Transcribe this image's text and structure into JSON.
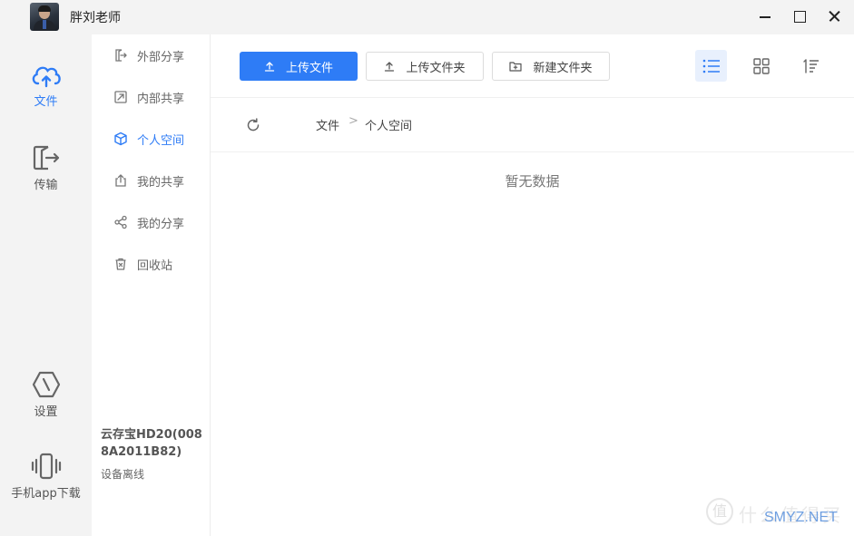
{
  "window": {
    "title": "胖刘老师",
    "controls": {
      "minimize": "minimize-icon",
      "maximize": "maximize-icon",
      "close": "close-icon"
    }
  },
  "rail": {
    "items": [
      {
        "label": "文件",
        "icon": "cloud-icon",
        "active": true
      },
      {
        "label": "传输",
        "icon": "transfer-icon",
        "active": false
      },
      {
        "label": "设置",
        "icon": "settings-icon",
        "active": false
      },
      {
        "label": "手机app下载",
        "icon": "phone-icon",
        "active": false
      }
    ]
  },
  "subnav": {
    "items": [
      {
        "label": "外部分享",
        "icon": "external-share-icon",
        "active": false
      },
      {
        "label": "内部共享",
        "icon": "internal-share-icon",
        "active": false
      },
      {
        "label": "个人空间",
        "icon": "cube-icon",
        "active": true
      },
      {
        "label": "我的共享",
        "icon": "upload-share-icon",
        "active": false
      },
      {
        "label": "我的分享",
        "icon": "share-nodes-icon",
        "active": false
      },
      {
        "label": "回收站",
        "icon": "trash-icon",
        "active": false
      }
    ],
    "device": {
      "name": "云存宝HD20(0088A2011B82)",
      "status": "设备离线"
    }
  },
  "toolbar": {
    "upload_file": "上传文件",
    "upload_folder": "上传文件夹",
    "new_folder": "新建文件夹",
    "view_list_icon": "list-view-icon",
    "view_grid_icon": "grid-view-icon",
    "sort_icon": "sort-icon"
  },
  "breadcrumb": {
    "items": [
      "文件",
      "个人空间"
    ],
    "separator": ">"
  },
  "content": {
    "empty_text": "暂无数据"
  },
  "watermark": {
    "text": "什么值得买",
    "site": "SMYZ.NET",
    "glyph": "值"
  },
  "colors": {
    "accent": "#2e7cf6",
    "rail_bg": "#f3f3f3",
    "active_view_bg": "#e8f0fd"
  }
}
